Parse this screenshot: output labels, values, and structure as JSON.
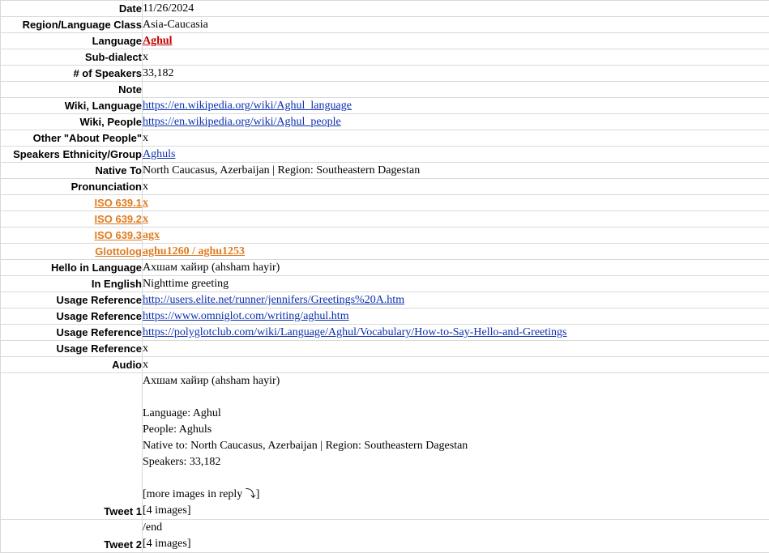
{
  "rows": {
    "date": {
      "label": "Date",
      "value": "11/26/2024"
    },
    "region": {
      "label": "Region/Language Class",
      "value": "Asia-Caucasia"
    },
    "language": {
      "label": "Language",
      "value": "Aghul"
    },
    "subdialect": {
      "label": "Sub-dialect",
      "value": "x"
    },
    "speakers": {
      "label": "# of Speakers",
      "value": "33,182"
    },
    "note": {
      "label": "Note",
      "value": ""
    },
    "wiki_language": {
      "label": "Wiki, Language",
      "value": "https://en.wikipedia.org/wiki/Aghul_language"
    },
    "wiki_people": {
      "label": "Wiki, People",
      "value": "https://en.wikipedia.org/wiki/Aghul_people"
    },
    "other_about": {
      "label": "Other \"About People\"",
      "value": "x"
    },
    "ethnicity": {
      "label": "Speakers Ethnicity/Group",
      "value": "Aghuls"
    },
    "native_to": {
      "label": "Native To",
      "value": "North Caucasus, Azerbaijan | Region: Southeastern Dagestan"
    },
    "pronunciation": {
      "label": "Pronunciation",
      "value": "x"
    },
    "iso1": {
      "label": "ISO 639.1",
      "value": "x"
    },
    "iso2": {
      "label": "ISO 639.2",
      "value": "x"
    },
    "iso3": {
      "label": "ISO 639.3",
      "value": "agx"
    },
    "glottolog": {
      "label": "Glottolog",
      "value": "aghu1260 / aghu1253"
    },
    "hello": {
      "label": "Hello in Language",
      "value": "Ахшам хайир (ahsham hayir)"
    },
    "in_english": {
      "label": "In English",
      "value": "Nighttime greeting"
    },
    "usage1": {
      "label": "Usage Reference",
      "value": "http://users.elite.net/runner/jennifers/Greetings%20A.htm"
    },
    "usage2": {
      "label": "Usage Reference",
      "value": "https://www.omniglot.com/writing/aghul.htm"
    },
    "usage3": {
      "label": "Usage Reference",
      "value": "https://polyglotclub.com/wiki/Language/Aghul/Vocabulary/How-to-Say-Hello-and-Greetings"
    },
    "usage4": {
      "label": "Usage Reference",
      "value": "x"
    },
    "audio": {
      "label": "Audio",
      "value": "x"
    }
  },
  "tweet1": {
    "label": "Tweet 1",
    "lines": [
      "Ахшам хайир (ahsham hayir)",
      "",
      "Language: Aghul",
      "People: Aghuls",
      "Native to: North Caucasus, Azerbaijan | Region: Southeastern Dagestan",
      "Speakers: 33,182",
      "",
      "[more images in reply ",
      "[4 images]"
    ],
    "reply_suffix": "]"
  },
  "tweet2": {
    "label": "Tweet 2",
    "lines": [
      "/end",
      "[4 images]"
    ]
  },
  "colors": {
    "link": "#0b2fb0",
    "red": "#c00000",
    "orange": "#e07b1f",
    "brown": "#b3561f",
    "green": "#0a7d12",
    "gridline": "#d9d9d9"
  },
  "icons": {
    "reply_arrow": "return-arrow-icon"
  }
}
